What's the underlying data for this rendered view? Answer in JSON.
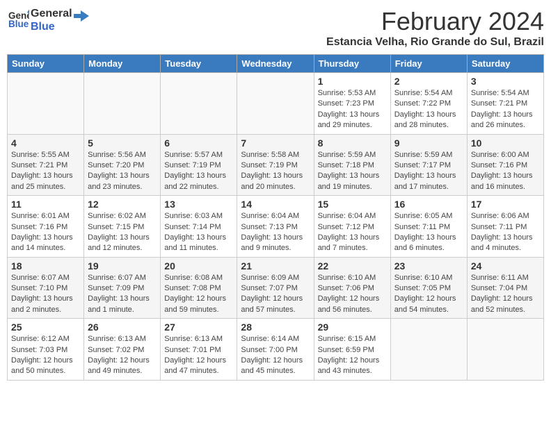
{
  "header": {
    "logo_line1": "General",
    "logo_line2": "Blue",
    "month": "February 2024",
    "location": "Estancia Velha, Rio Grande do Sul, Brazil"
  },
  "days_of_week": [
    "Sunday",
    "Monday",
    "Tuesday",
    "Wednesday",
    "Thursday",
    "Friday",
    "Saturday"
  ],
  "weeks": [
    [
      {
        "day": "",
        "info": ""
      },
      {
        "day": "",
        "info": ""
      },
      {
        "day": "",
        "info": ""
      },
      {
        "day": "",
        "info": ""
      },
      {
        "day": "1",
        "info": "Sunrise: 5:53 AM\nSunset: 7:23 PM\nDaylight: 13 hours\nand 29 minutes."
      },
      {
        "day": "2",
        "info": "Sunrise: 5:54 AM\nSunset: 7:22 PM\nDaylight: 13 hours\nand 28 minutes."
      },
      {
        "day": "3",
        "info": "Sunrise: 5:54 AM\nSunset: 7:21 PM\nDaylight: 13 hours\nand 26 minutes."
      }
    ],
    [
      {
        "day": "4",
        "info": "Sunrise: 5:55 AM\nSunset: 7:21 PM\nDaylight: 13 hours\nand 25 minutes."
      },
      {
        "day": "5",
        "info": "Sunrise: 5:56 AM\nSunset: 7:20 PM\nDaylight: 13 hours\nand 23 minutes."
      },
      {
        "day": "6",
        "info": "Sunrise: 5:57 AM\nSunset: 7:19 PM\nDaylight: 13 hours\nand 22 minutes."
      },
      {
        "day": "7",
        "info": "Sunrise: 5:58 AM\nSunset: 7:19 PM\nDaylight: 13 hours\nand 20 minutes."
      },
      {
        "day": "8",
        "info": "Sunrise: 5:59 AM\nSunset: 7:18 PM\nDaylight: 13 hours\nand 19 minutes."
      },
      {
        "day": "9",
        "info": "Sunrise: 5:59 AM\nSunset: 7:17 PM\nDaylight: 13 hours\nand 17 minutes."
      },
      {
        "day": "10",
        "info": "Sunrise: 6:00 AM\nSunset: 7:16 PM\nDaylight: 13 hours\nand 16 minutes."
      }
    ],
    [
      {
        "day": "11",
        "info": "Sunrise: 6:01 AM\nSunset: 7:16 PM\nDaylight: 13 hours\nand 14 minutes."
      },
      {
        "day": "12",
        "info": "Sunrise: 6:02 AM\nSunset: 7:15 PM\nDaylight: 13 hours\nand 12 minutes."
      },
      {
        "day": "13",
        "info": "Sunrise: 6:03 AM\nSunset: 7:14 PM\nDaylight: 13 hours\nand 11 minutes."
      },
      {
        "day": "14",
        "info": "Sunrise: 6:04 AM\nSunset: 7:13 PM\nDaylight: 13 hours\nand 9 minutes."
      },
      {
        "day": "15",
        "info": "Sunrise: 6:04 AM\nSunset: 7:12 PM\nDaylight: 13 hours\nand 7 minutes."
      },
      {
        "day": "16",
        "info": "Sunrise: 6:05 AM\nSunset: 7:11 PM\nDaylight: 13 hours\nand 6 minutes."
      },
      {
        "day": "17",
        "info": "Sunrise: 6:06 AM\nSunset: 7:11 PM\nDaylight: 13 hours\nand 4 minutes."
      }
    ],
    [
      {
        "day": "18",
        "info": "Sunrise: 6:07 AM\nSunset: 7:10 PM\nDaylight: 13 hours\nand 2 minutes."
      },
      {
        "day": "19",
        "info": "Sunrise: 6:07 AM\nSunset: 7:09 PM\nDaylight: 13 hours\nand 1 minute."
      },
      {
        "day": "20",
        "info": "Sunrise: 6:08 AM\nSunset: 7:08 PM\nDaylight: 12 hours\nand 59 minutes."
      },
      {
        "day": "21",
        "info": "Sunrise: 6:09 AM\nSunset: 7:07 PM\nDaylight: 12 hours\nand 57 minutes."
      },
      {
        "day": "22",
        "info": "Sunrise: 6:10 AM\nSunset: 7:06 PM\nDaylight: 12 hours\nand 56 minutes."
      },
      {
        "day": "23",
        "info": "Sunrise: 6:10 AM\nSunset: 7:05 PM\nDaylight: 12 hours\nand 54 minutes."
      },
      {
        "day": "24",
        "info": "Sunrise: 6:11 AM\nSunset: 7:04 PM\nDaylight: 12 hours\nand 52 minutes."
      }
    ],
    [
      {
        "day": "25",
        "info": "Sunrise: 6:12 AM\nSunset: 7:03 PM\nDaylight: 12 hours\nand 50 minutes."
      },
      {
        "day": "26",
        "info": "Sunrise: 6:13 AM\nSunset: 7:02 PM\nDaylight: 12 hours\nand 49 minutes."
      },
      {
        "day": "27",
        "info": "Sunrise: 6:13 AM\nSunset: 7:01 PM\nDaylight: 12 hours\nand 47 minutes."
      },
      {
        "day": "28",
        "info": "Sunrise: 6:14 AM\nSunset: 7:00 PM\nDaylight: 12 hours\nand 45 minutes."
      },
      {
        "day": "29",
        "info": "Sunrise: 6:15 AM\nSunset: 6:59 PM\nDaylight: 12 hours\nand 43 minutes."
      },
      {
        "day": "",
        "info": ""
      },
      {
        "day": "",
        "info": ""
      }
    ]
  ]
}
